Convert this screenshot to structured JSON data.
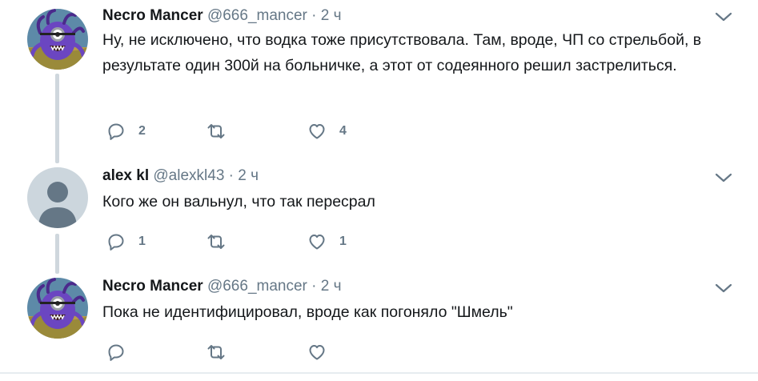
{
  "tweets": [
    {
      "name": "Necro Mancer",
      "handle": "@666_mancer",
      "separator": "·",
      "time": "2 ч",
      "text": "Ну, не исключено, что водка тоже присутствовала. Там, вроде, ЧП со стрельбой, в результате один 300й на больничке, а этот от содеянного решил застрелиться.",
      "reply_count": "2",
      "retweet_count": "",
      "like_count": "4",
      "avatar": "minion-avatar"
    },
    {
      "name": "alex kl",
      "handle": "@alexkl43",
      "separator": "·",
      "time": "2 ч",
      "text": "Кого же он вальнул, что так пересрал",
      "reply_count": "1",
      "retweet_count": "",
      "like_count": "1",
      "avatar": "default-avatar"
    },
    {
      "name": "Necro Mancer",
      "handle": "@666_mancer",
      "separator": "·",
      "time": "2 ч",
      "text": "Пока не идентифицировал, вроде как погоняло \"Шмель\"",
      "reply_count": "",
      "retweet_count": "",
      "like_count": "",
      "avatar": "minion-avatar"
    }
  ],
  "colors": {
    "icon_gray": "#657786",
    "thread_line": "#cfd7dd",
    "avatar_purple": "#6b46c1",
    "default_avatar_bg": "#ccd6dd"
  }
}
